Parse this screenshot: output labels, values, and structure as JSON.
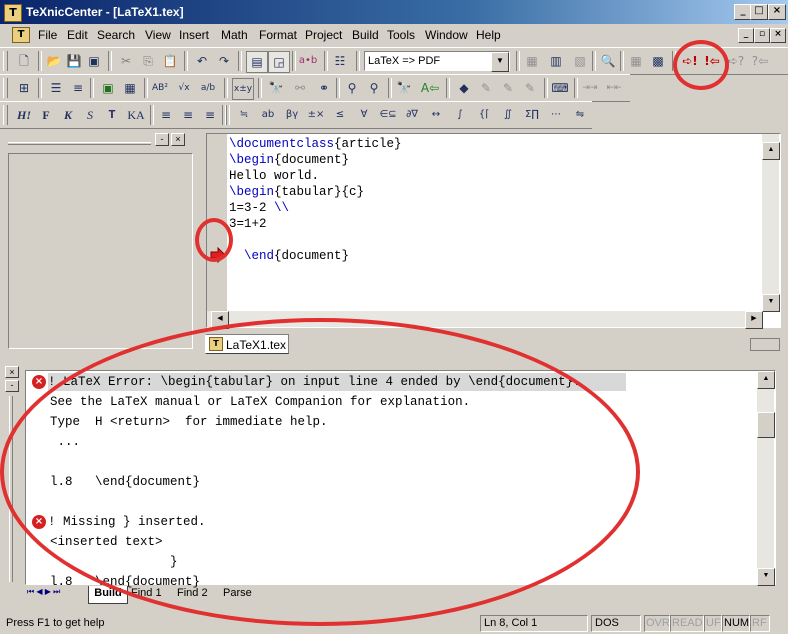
{
  "window": {
    "title": "TeXnicCenter - [LaTeX1.tex]",
    "app_icon": "T"
  },
  "menu": [
    "File",
    "Edit",
    "Search",
    "View",
    "Insert",
    "Math",
    "Format",
    "Project",
    "Build",
    "Tools",
    "Window",
    "Help"
  ],
  "toolbar": {
    "build_profile": "LaTeX => PDF",
    "text_style_buttons": [
      "H!",
      "F",
      "K",
      "S",
      "T",
      "KA"
    ]
  },
  "editor": {
    "lines": [
      {
        "cmd": "\\documentclass",
        "arg": "{article}"
      },
      {
        "cmd": "\\begin",
        "arg": "{document}"
      },
      {
        "cmd": "",
        "arg": "Hello world."
      },
      {
        "cmd": "\\begin",
        "arg": "{tabular}{c}"
      },
      {
        "cmd": "",
        "arg": "1=3-2 ",
        "tail": "\\\\"
      },
      {
        "cmd": "",
        "arg": "3=1+2"
      },
      {
        "cmd": "",
        "arg": ""
      },
      {
        "cmd": "  \\end",
        "arg": "{document}"
      }
    ],
    "tab_label": "LaTeX1.tex"
  },
  "output": {
    "lines": [
      {
        "text": "! LaTeX Error: \\begin{tabular} on input line 4 ended by \\end{document}.",
        "error": true,
        "highlight": true
      },
      {
        "text": "See the LaTeX manual or LaTeX Companion for explanation."
      },
      {
        "text": "Type  H <return>  for immediate help."
      },
      {
        "text": " ..."
      },
      {
        "text": ""
      },
      {
        "text": "l.8   \\end{document}"
      },
      {
        "text": ""
      },
      {
        "text": "! Missing } inserted.",
        "error": true
      },
      {
        "text": "<inserted text>"
      },
      {
        "text": "                }"
      },
      {
        "text": "l.8   \\end{document}"
      }
    ],
    "tabs": [
      "Build",
      "Find 1",
      "Find 2",
      "Parse"
    ],
    "active_tab": "Build"
  },
  "status": {
    "help": "Press F1 to get help",
    "position": "Ln 8, Col 1",
    "format": "DOS",
    "indicators": [
      {
        "label": "OVR",
        "active": false
      },
      {
        "label": "READ",
        "active": false
      },
      {
        "label": "UF",
        "active": false
      },
      {
        "label": "NUM",
        "active": true
      },
      {
        "label": "RF",
        "active": false
      }
    ]
  },
  "colors": {
    "annotation_ring": "#e03030",
    "keyword": "#0000c0",
    "error_icon": "#d42020"
  }
}
